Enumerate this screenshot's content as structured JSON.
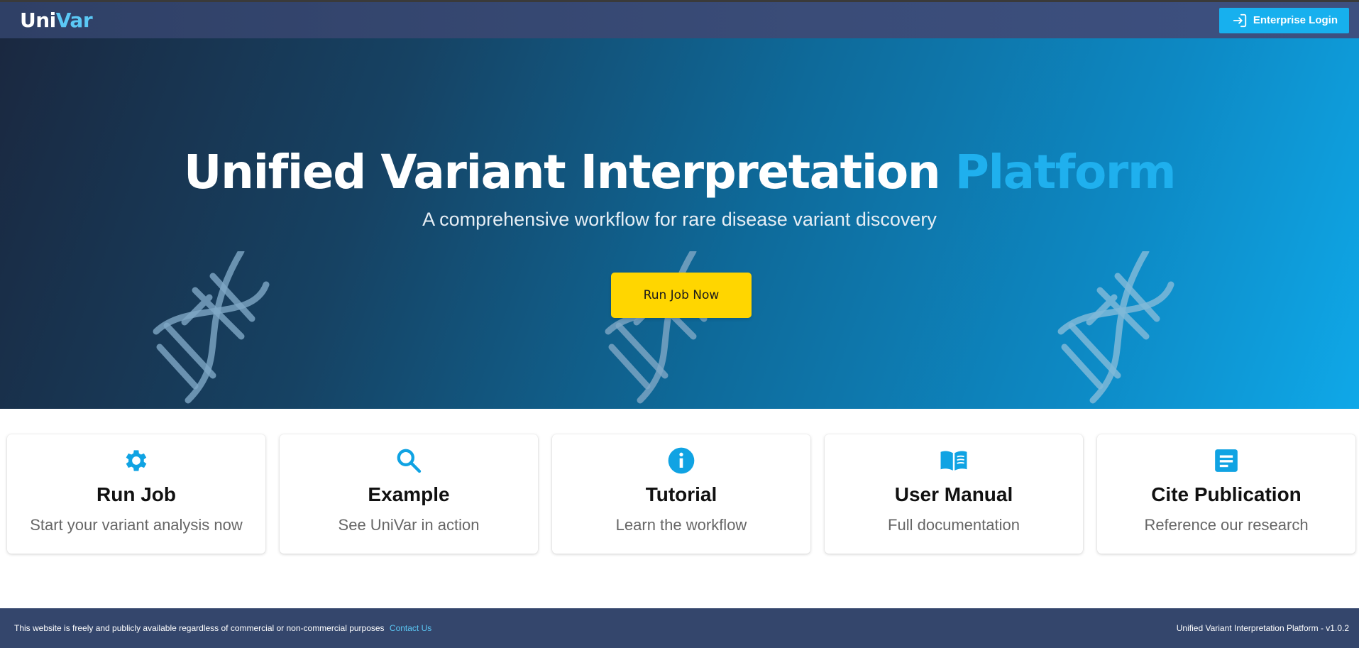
{
  "navbar": {
    "brand_part1": "Uni",
    "brand_part2": "Var",
    "login_label": "Enterprise Login",
    "login_icon": "login-icon"
  },
  "hero": {
    "title_main": "Unified Variant Interpretation ",
    "title_accent": "Platform",
    "subtitle": "A comprehensive workflow for rare disease variant discovery",
    "cta_label": "Run Job Now",
    "decoration_icon": "dna-icon"
  },
  "cards": [
    {
      "icon": "gear-icon",
      "title": "Run Job",
      "description": "Start your variant analysis now"
    },
    {
      "icon": "search-icon",
      "title": "Example",
      "description": "See UniVar in action"
    },
    {
      "icon": "info-icon",
      "title": "Tutorial",
      "description": "Learn the workflow"
    },
    {
      "icon": "book-icon",
      "title": "User Manual",
      "description": "Full documentation"
    },
    {
      "icon": "document-icon",
      "title": "Cite Publication",
      "description": "Reference our research"
    }
  ],
  "footer": {
    "notice": "This website is freely and publicly available regardless of commercial or non-commercial purposes",
    "contact_label": "Contact Us",
    "version_text": "Unified Variant Interpretation Platform - v1.0.2"
  },
  "colors": {
    "navbar": "#34466c",
    "accent": "#17b0ee",
    "cta": "#ffd600",
    "footer": "#34466c"
  }
}
